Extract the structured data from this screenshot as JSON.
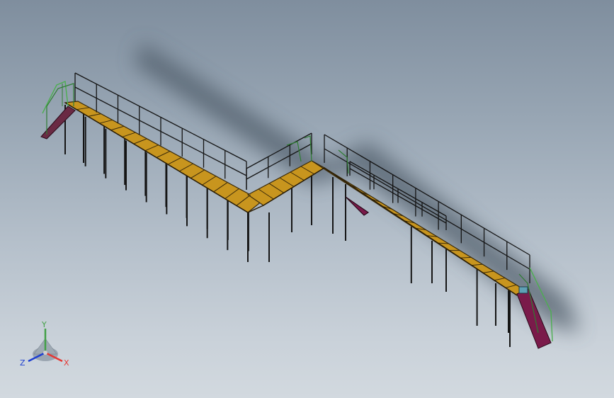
{
  "viewport": {
    "background_top": "#7f8e9e",
    "background_bottom": "#d2d9df"
  },
  "model": {
    "description_colors": {
      "deck": "#c8951e",
      "deck_lines": "#3a2a0a",
      "posts": "#1a1a1a",
      "railing": "#1a1a1a",
      "stair_rail": "#4caf50",
      "stair_stringer": "#7a1a4a"
    }
  },
  "triad": {
    "x_label": "X",
    "y_label": "Y",
    "z_label": "Z",
    "x_color": "#e53935",
    "y_color": "#43a047",
    "z_color": "#1e3fd0"
  }
}
